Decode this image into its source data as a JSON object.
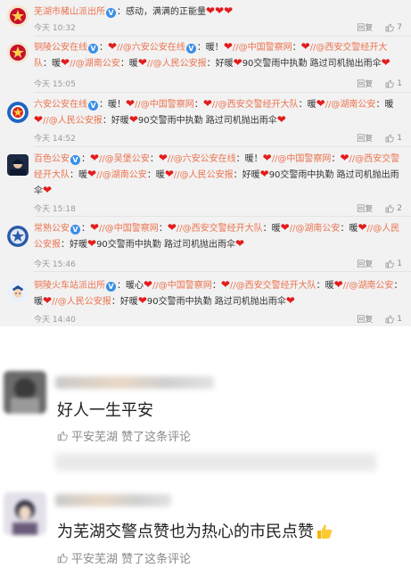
{
  "weibo": {
    "action_repost": "回复",
    "comments": [
      {
        "segments": [
          {
            "t": "nick",
            "v": "芜湖市赭山派出所"
          },
          {
            "t": "v"
          },
          {
            "t": "plain",
            "v": "：感动，满满的正能量"
          },
          {
            "t": "hearts",
            "n": 3
          }
        ],
        "time": "今天 10:32",
        "likes": "7"
      },
      {
        "segments": [
          {
            "t": "nick",
            "v": "铜陵公安在线"
          },
          {
            "t": "v"
          },
          {
            "t": "plain",
            "v": "："
          },
          {
            "t": "hearts",
            "n": 1
          },
          {
            "t": "mention",
            "v": "//@六安公安在线"
          },
          {
            "t": "v"
          },
          {
            "t": "plain",
            "v": "：暖！"
          },
          {
            "t": "hearts",
            "n": 1
          },
          {
            "t": "mention",
            "v": "//@中国警察网"
          },
          {
            "t": "plain",
            "v": "："
          },
          {
            "t": "hearts",
            "n": 1
          },
          {
            "t": "mention",
            "v": "//@西安交警经开大队"
          },
          {
            "t": "plain",
            "v": "：暖"
          },
          {
            "t": "hearts",
            "n": 1
          },
          {
            "t": "mention",
            "v": "//@湖南公安"
          },
          {
            "t": "plain",
            "v": "：暖"
          },
          {
            "t": "hearts",
            "n": 1
          },
          {
            "t": "mention",
            "v": "//@人民公安报"
          },
          {
            "t": "plain",
            "v": "：好暖"
          },
          {
            "t": "hearts",
            "n": 1
          },
          {
            "t": "plain",
            "v": "90交警雨中执勤 路过司机抛出雨伞"
          },
          {
            "t": "hearts",
            "n": 1
          }
        ],
        "time": "今天 15:05",
        "likes": "1"
      },
      {
        "segments": [
          {
            "t": "nick",
            "v": "六安公安在线"
          },
          {
            "t": "v"
          },
          {
            "t": "plain",
            "v": "：暖！"
          },
          {
            "t": "hearts",
            "n": 1
          },
          {
            "t": "mention",
            "v": "//@中国警察网"
          },
          {
            "t": "plain",
            "v": "："
          },
          {
            "t": "hearts",
            "n": 1
          },
          {
            "t": "mention",
            "v": "//@西安交警经开大队"
          },
          {
            "t": "plain",
            "v": "：暖"
          },
          {
            "t": "hearts",
            "n": 1
          },
          {
            "t": "mention",
            "v": "//@湖南公安"
          },
          {
            "t": "plain",
            "v": "：暖"
          },
          {
            "t": "hearts",
            "n": 1
          },
          {
            "t": "mention",
            "v": "//@人民公安报"
          },
          {
            "t": "plain",
            "v": "：好暖"
          },
          {
            "t": "hearts",
            "n": 1
          },
          {
            "t": "plain",
            "v": "90交警雨中执勤 路过司机抛出雨伞"
          },
          {
            "t": "hearts",
            "n": 1
          }
        ],
        "time": "今天 14:52",
        "likes": "1"
      },
      {
        "segments": [
          {
            "t": "nick",
            "v": "百色公安"
          },
          {
            "t": "v"
          },
          {
            "t": "plain",
            "v": "："
          },
          {
            "t": "hearts",
            "n": 1
          },
          {
            "t": "mention",
            "v": "//@吴堡公安"
          },
          {
            "t": "plain",
            "v": "："
          },
          {
            "t": "hearts",
            "n": 1
          },
          {
            "t": "mention",
            "v": "//@六安公安在线"
          },
          {
            "t": "plain",
            "v": "：暖！"
          },
          {
            "t": "hearts",
            "n": 1
          },
          {
            "t": "mention",
            "v": "//@中国警察网"
          },
          {
            "t": "plain",
            "v": "："
          },
          {
            "t": "hearts",
            "n": 1
          },
          {
            "t": "mention",
            "v": "//@西安交警经开大队"
          },
          {
            "t": "plain",
            "v": "：暖"
          },
          {
            "t": "hearts",
            "n": 1
          },
          {
            "t": "mention",
            "v": "//@湖南公安"
          },
          {
            "t": "plain",
            "v": "：暖"
          },
          {
            "t": "hearts",
            "n": 1
          },
          {
            "t": "mention",
            "v": "//@人民公安报"
          },
          {
            "t": "plain",
            "v": "：好暖"
          },
          {
            "t": "hearts",
            "n": 1
          },
          {
            "t": "plain",
            "v": "90交警雨中执勤 路过司机抛出雨伞"
          },
          {
            "t": "hearts",
            "n": 1
          }
        ],
        "time": "今天 15:18",
        "likes": "2"
      },
      {
        "segments": [
          {
            "t": "nick",
            "v": "常熟公安"
          },
          {
            "t": "v"
          },
          {
            "t": "plain",
            "v": "："
          },
          {
            "t": "hearts",
            "n": 1
          },
          {
            "t": "mention",
            "v": "//@中国警察网"
          },
          {
            "t": "plain",
            "v": "："
          },
          {
            "t": "hearts",
            "n": 1
          },
          {
            "t": "mention",
            "v": "//@西安交警经开大队"
          },
          {
            "t": "plain",
            "v": "：暖"
          },
          {
            "t": "hearts",
            "n": 1
          },
          {
            "t": "mention",
            "v": "//@湖南公安"
          },
          {
            "t": "plain",
            "v": "：暖"
          },
          {
            "t": "hearts",
            "n": 1
          },
          {
            "t": "mention",
            "v": "//@人民公安报"
          },
          {
            "t": "plain",
            "v": "：好暖"
          },
          {
            "t": "hearts",
            "n": 1
          },
          {
            "t": "plain",
            "v": "90交警雨中执勤 路过司机抛出雨伞"
          },
          {
            "t": "hearts",
            "n": 1
          }
        ],
        "time": "今天 15:46",
        "likes": "1"
      },
      {
        "segments": [
          {
            "t": "nick",
            "v": "铜陵火车站派出所"
          },
          {
            "t": "v"
          },
          {
            "t": "plain",
            "v": "："
          },
          {
            "t": "plain",
            "v": "暖心"
          },
          {
            "t": "hearts",
            "n": 1
          },
          {
            "t": "mention",
            "v": "//@中国警察网"
          },
          {
            "t": "plain",
            "v": "："
          },
          {
            "t": "hearts",
            "n": 1
          },
          {
            "t": "mention",
            "v": "//@西安交警经开大队"
          },
          {
            "t": "plain",
            "v": "：暖"
          },
          {
            "t": "hearts",
            "n": 1
          },
          {
            "t": "mention",
            "v": "//@湖南公安"
          },
          {
            "t": "plain",
            "v": "：暖"
          },
          {
            "t": "hearts",
            "n": 1
          },
          {
            "t": "mention",
            "v": "//@人民公安报"
          },
          {
            "t": "plain",
            "v": "：好暖"
          },
          {
            "t": "hearts",
            "n": 1
          },
          {
            "t": "plain",
            "v": "90交警雨中执勤 路过司机抛出雨伞"
          },
          {
            "t": "hearts",
            "n": 1
          }
        ],
        "time": "今天 14:40",
        "likes": "1"
      }
    ]
  },
  "wechat": {
    "comments": [
      {
        "text": "好人一生平安",
        "liked_by": "平安芜湖 赞了这条评论"
      },
      {
        "text": "为芜湖交警点赞也为热心的市民点赞",
        "liked_by": "平安芜湖 赞了这条评论"
      }
    ]
  },
  "colors": {
    "nick": "#eb7350",
    "heart": "#e31c1c",
    "verified": "#3a8ee6"
  },
  "icons": [
    "police-badge-icon",
    "verified-icon",
    "heart-icon",
    "like-thumb-icon",
    "thumbs-up-emoji-icon"
  ]
}
